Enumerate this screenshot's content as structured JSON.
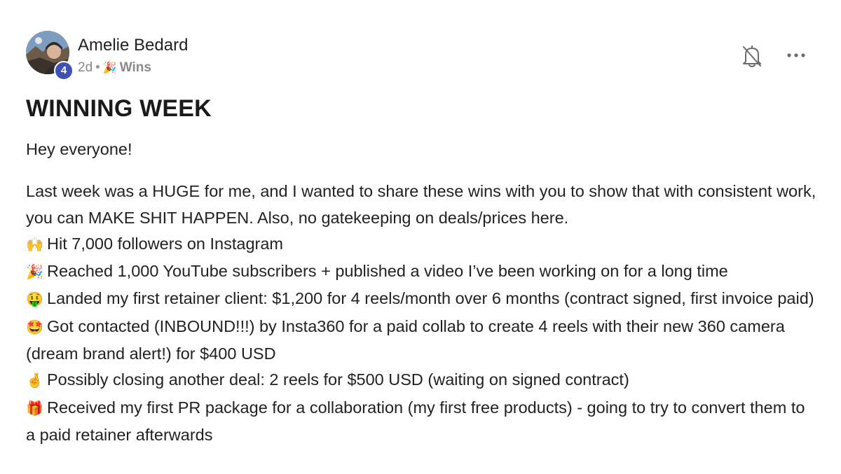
{
  "author": {
    "name": "Amelie Bedard",
    "level": "4"
  },
  "meta": {
    "time": "2d",
    "separator": "•",
    "category_emoji": "🎉",
    "category": "Wins"
  },
  "actions": {
    "bell_icon": "bell-off-icon",
    "more_icon": "more-horizontal-icon"
  },
  "post": {
    "title": "WINNING WEEK",
    "greeting": "Hey everyone!",
    "intro": "Last week was a HUGE for me, and I wanted to share these wins with you to show that with consistent work, you can MAKE SHIT HAPPEN. Also, no gatekeeping on deals/prices here.",
    "wins": [
      {
        "emoji": "🙌",
        "text": "Hit 7,000 followers on Instagram"
      },
      {
        "emoji": "🎉",
        "text": "Reached 1,000 YouTube subscribers + published a video I’ve been working on for a long time"
      },
      {
        "emoji": "🤑",
        "text": "Landed my first retainer client: $1,200 for 4 reels/month over 6 months (contract signed, first invoice paid)"
      },
      {
        "emoji": "🤩",
        "text": "Got contacted (INBOUND!!!) by Insta360 for a paid collab to create 4 reels with their new 360 camera (dream brand alert!) for $400 USD"
      },
      {
        "emoji": "🤞",
        "text": "Possibly closing another deal: 2 reels for $500 USD (waiting on signed contract)"
      },
      {
        "emoji": "🎁",
        "text": "Received my first PR package for a collaboration (my first free products) - going to try to convert them to a paid retainer afterwards"
      }
    ]
  },
  "colors": {
    "badge": "#3f51b5",
    "text": "#222222",
    "meta": "#888888"
  }
}
